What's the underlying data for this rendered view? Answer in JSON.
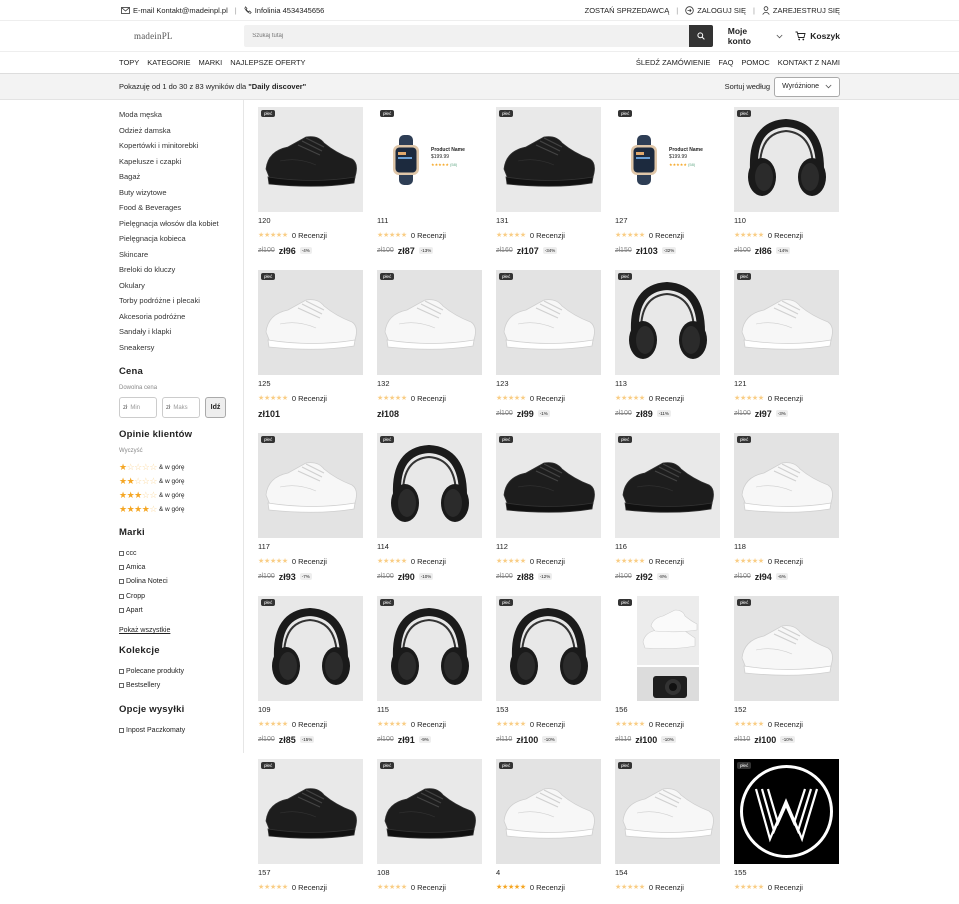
{
  "topbar": {
    "email": "E-mail Kontakt@madeinpl.pl",
    "hotline": "Infolinia 4534345656",
    "become_seller": "ZOSTAŃ SPRZEDAWCĄ",
    "login": "ZALOGUJ SIĘ",
    "register": "ZAREJESTRUJ SIĘ"
  },
  "header": {
    "logo": "madeinPL",
    "search_placeholder": "Szukaj tutaj",
    "account": "Moje konto",
    "cart": "Koszyk"
  },
  "nav": {
    "left": [
      "TOPY",
      "KATEGORIE",
      "MARKI",
      "NAJLEPSZE OFERTY"
    ],
    "right": [
      "ŚLEDŹ ZAMÓWIENIE",
      "FAQ",
      "POMOC",
      "KONTAKT Z NAMI"
    ]
  },
  "results": {
    "text": "Pokazuję od 1 do 30 z 83 wyników dla ",
    "query": "\"Daily discover\"",
    "sort_label": "Sortuj według",
    "sort_value": "Wyróżnione"
  },
  "sidebar": {
    "categories": [
      "Moda męska",
      "Odzież damska",
      "Kopertówki i minitorebki",
      "Kapelusze i czapki",
      "Bagaż",
      "Buty wizytowe",
      "Food & Beverages",
      "Pielęgnacja włosów dla kobiet",
      "Pielęgnacja kobieca",
      "Skincare",
      "Breloki do kluczy",
      "Okulary",
      "Torby podróżne i plecaki",
      "Akcesoria podróżne",
      "Sandały i klapki",
      "Sneakersy"
    ],
    "price": {
      "title": "Cena",
      "sub": "Dowolna cena",
      "currency": "zł",
      "min": "Min",
      "max": "Maks",
      "go": "Idź"
    },
    "ratings": {
      "title": "Opinie klientów",
      "sub": "Wyczyść",
      "suffix": "& w górę"
    },
    "brands": {
      "title": "Marki",
      "items": [
        "ccc",
        "Amica",
        "Dolina Noteci",
        "Cropp",
        "Apart"
      ],
      "show_all": "Pokaż wszystkie"
    },
    "collections": {
      "title": "Kolekcje",
      "items": [
        "Polecane produkty",
        "Bestsellery"
      ]
    },
    "shipping": {
      "title": "Opcje wysyłki",
      "items": [
        "Inpost Paczkomaty"
      ]
    }
  },
  "products": [
    {
      "id": "120",
      "img": "black",
      "reviews": "0 Recenzji",
      "old": "zł100",
      "now": "zł96",
      "disc": "-4%",
      "rating": 0
    },
    {
      "id": "111",
      "img": "watch",
      "reviews": "0 Recenzji",
      "old": "zł100",
      "now": "zł87",
      "disc": "-13%",
      "rating": 0
    },
    {
      "id": "131",
      "img": "black",
      "reviews": "0 Recenzji",
      "old": "zł160",
      "now": "zł107",
      "disc": "-34%",
      "rating": 0
    },
    {
      "id": "127",
      "img": "watch",
      "reviews": "0 Recenzji",
      "old": "zł150",
      "now": "zł103",
      "disc": "-32%",
      "rating": 0
    },
    {
      "id": "110",
      "img": "headphones",
      "reviews": "0 Recenzji",
      "old": "zł100",
      "now": "zł86",
      "disc": "-14%",
      "rating": 0
    },
    {
      "id": "125",
      "img": "white",
      "reviews": "0 Recenzji",
      "old": "",
      "now": "zł101",
      "disc": "",
      "rating": 0
    },
    {
      "id": "132",
      "img": "white",
      "reviews": "0 Recenzji",
      "old": "",
      "now": "zł108",
      "disc": "",
      "rating": 0
    },
    {
      "id": "123",
      "img": "white",
      "reviews": "0 Recenzji",
      "old": "zł100",
      "now": "zł99",
      "disc": "-1%",
      "rating": 0
    },
    {
      "id": "113",
      "img": "headphones",
      "reviews": "0 Recenzji",
      "old": "zł100",
      "now": "zł89",
      "disc": "-11%",
      "rating": 0
    },
    {
      "id": "121",
      "img": "white",
      "reviews": "0 Recenzji",
      "old": "zł100",
      "now": "zł97",
      "disc": "-3%",
      "rating": 0
    },
    {
      "id": "117",
      "img": "white",
      "reviews": "0 Recenzji",
      "old": "zł100",
      "now": "zł93",
      "disc": "-7%",
      "rating": 0
    },
    {
      "id": "114",
      "img": "headphones",
      "reviews": "0 Recenzji",
      "old": "zł100",
      "now": "zł90",
      "disc": "-10%",
      "rating": 0
    },
    {
      "id": "112",
      "img": "black",
      "reviews": "0 Recenzji",
      "old": "zł100",
      "now": "zł88",
      "disc": "-12%",
      "rating": 0
    },
    {
      "id": "116",
      "img": "black",
      "reviews": "0 Recenzji",
      "old": "zł100",
      "now": "zł92",
      "disc": "-8%",
      "rating": 0
    },
    {
      "id": "118",
      "img": "white",
      "reviews": "0 Recenzji",
      "old": "zł100",
      "now": "zł94",
      "disc": "-6%",
      "rating": 0
    },
    {
      "id": "109",
      "img": "headphones",
      "reviews": "0 Recenzji",
      "old": "zł100",
      "now": "zł85",
      "disc": "-15%",
      "rating": 0
    },
    {
      "id": "115",
      "img": "headphones",
      "reviews": "0 Recenzji",
      "old": "zł100",
      "now": "zł91",
      "disc": "-9%",
      "rating": 0
    },
    {
      "id": "153",
      "img": "headphones",
      "reviews": "0 Recenzji",
      "old": "zł110",
      "now": "zł100",
      "disc": "-10%",
      "rating": 0
    },
    {
      "id": "156",
      "img": "combo",
      "reviews": "0 Recenzji",
      "old": "zł110",
      "now": "zł100",
      "disc": "-10%",
      "rating": 0
    },
    {
      "id": "152",
      "img": "white",
      "reviews": "0 Recenzji",
      "old": "zł110",
      "now": "zł100",
      "disc": "-10%",
      "rating": 0
    },
    {
      "id": "157",
      "img": "black",
      "reviews": "0 Recenzji",
      "old": "",
      "now": "",
      "disc": "",
      "rating": 0
    },
    {
      "id": "108",
      "img": "black",
      "reviews": "0 Recenzji",
      "old": "",
      "now": "",
      "disc": "",
      "rating": 0
    },
    {
      "id": "4",
      "img": "white",
      "reviews": "0 Recenzji",
      "old": "",
      "now": "",
      "disc": "",
      "rating": 5
    },
    {
      "id": "154",
      "img": "white",
      "reviews": "0 Recenzji",
      "old": "",
      "now": "",
      "disc": "",
      "rating": 0
    },
    {
      "id": "155",
      "img": "logo",
      "reviews": "0 Recenzji",
      "old": "",
      "now": "",
      "disc": "",
      "rating": 0
    }
  ],
  "badge": "płeć",
  "watch_card": {
    "name": "Product Name",
    "price": "$199.99",
    "count": "(58)"
  },
  "colors": {
    "star": "#f5a623",
    "dark": "#333333",
    "bg_bar": "#f3f3f3"
  }
}
